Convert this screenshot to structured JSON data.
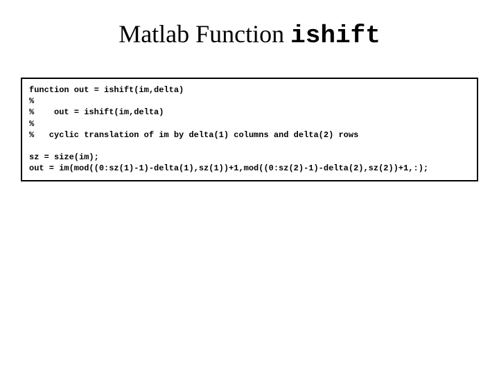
{
  "title": {
    "prefix": "Matlab Function ",
    "mono": "ishift"
  },
  "code": {
    "line1": "function out = ishift(im,delta)",
    "line2": "%",
    "line3": "%    out = ishift(im,delta)",
    "line4": "%",
    "line5": "%   cyclic translation of im by delta(1) columns and delta(2) rows",
    "line6": "",
    "line7": "sz = size(im);",
    "line8": "out = im(mod((0:sz(1)-1)-delta(1),sz(1))+1,mod((0:sz(2)-1)-delta(2),sz(2))+1,:);"
  }
}
